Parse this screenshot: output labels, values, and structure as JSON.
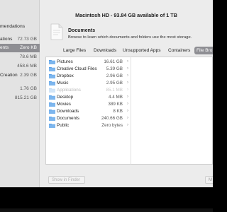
{
  "title": "Macintosh HD - 93.84 GB available of 1 TB",
  "sidebar": {
    "items": [
      {
        "label": "mendations",
        "size": ""
      },
      {
        "label": "ations",
        "size": "72.73 GB"
      },
      {
        "label": "ents",
        "size": "Zero KB"
      },
      {
        "label": "",
        "size": "78.6 MB"
      },
      {
        "label": "",
        "size": "458.6 MB"
      },
      {
        "label": "Creation",
        "size": "2.39 GB"
      },
      {
        "label": "",
        "size": "1.76 GB"
      },
      {
        "label": "",
        "size": "815.21 GB"
      }
    ]
  },
  "documents": {
    "title": "Documents",
    "subtitle": "Browse to learn which documents and folders use the most storage."
  },
  "tabs": [
    {
      "label": "Large Files"
    },
    {
      "label": "Downloads"
    },
    {
      "label": "Unsupported Apps"
    },
    {
      "label": "Containers"
    },
    {
      "label": "File Bro"
    }
  ],
  "files": [
    {
      "name": "Pictures",
      "size": "16.61 GB"
    },
    {
      "name": "Creative Cloud Files",
      "size": "5.39 GB"
    },
    {
      "name": "Dropbox",
      "size": "2.96 GB"
    },
    {
      "name": "Music",
      "size": "2.95 GB"
    },
    {
      "name": "Applications",
      "size": "85.1 MB"
    },
    {
      "name": "Desktop",
      "size": "4.4 MB"
    },
    {
      "name": "Movies",
      "size": "389 KB"
    },
    {
      "name": "Downloads",
      "size": "8 KB"
    },
    {
      "name": "Documents",
      "size": "240.66 GB"
    },
    {
      "name": "Public",
      "size": "Zero bytes"
    }
  ],
  "buttons": {
    "show_in_finder": "Show in Finder",
    "more": "M"
  },
  "colors": {
    "selected_tab": "#8e8e93",
    "folder": "#5aa0e6"
  }
}
